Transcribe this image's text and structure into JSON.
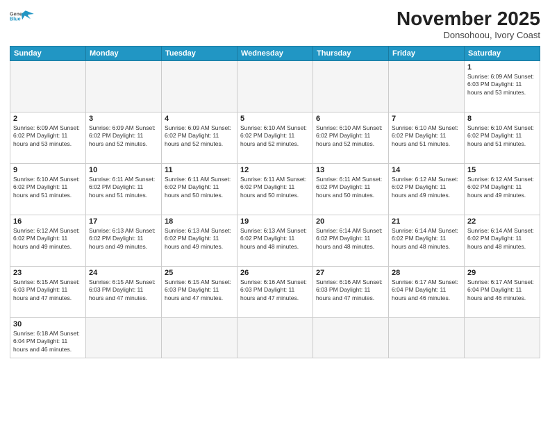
{
  "logo": {
    "line1": "General",
    "line2": "Blue"
  },
  "title": "November 2025",
  "location": "Donsohoou, Ivory Coast",
  "weekdays": [
    "Sunday",
    "Monday",
    "Tuesday",
    "Wednesday",
    "Thursday",
    "Friday",
    "Saturday"
  ],
  "weeks": [
    [
      {
        "day": "",
        "info": ""
      },
      {
        "day": "",
        "info": ""
      },
      {
        "day": "",
        "info": ""
      },
      {
        "day": "",
        "info": ""
      },
      {
        "day": "",
        "info": ""
      },
      {
        "day": "",
        "info": ""
      },
      {
        "day": "1",
        "info": "Sunrise: 6:09 AM\nSunset: 6:03 PM\nDaylight: 11 hours\nand 53 minutes."
      }
    ],
    [
      {
        "day": "2",
        "info": "Sunrise: 6:09 AM\nSunset: 6:02 PM\nDaylight: 11 hours\nand 53 minutes."
      },
      {
        "day": "3",
        "info": "Sunrise: 6:09 AM\nSunset: 6:02 PM\nDaylight: 11 hours\nand 52 minutes."
      },
      {
        "day": "4",
        "info": "Sunrise: 6:09 AM\nSunset: 6:02 PM\nDaylight: 11 hours\nand 52 minutes."
      },
      {
        "day": "5",
        "info": "Sunrise: 6:10 AM\nSunset: 6:02 PM\nDaylight: 11 hours\nand 52 minutes."
      },
      {
        "day": "6",
        "info": "Sunrise: 6:10 AM\nSunset: 6:02 PM\nDaylight: 11 hours\nand 52 minutes."
      },
      {
        "day": "7",
        "info": "Sunrise: 6:10 AM\nSunset: 6:02 PM\nDaylight: 11 hours\nand 51 minutes."
      },
      {
        "day": "8",
        "info": "Sunrise: 6:10 AM\nSunset: 6:02 PM\nDaylight: 11 hours\nand 51 minutes."
      }
    ],
    [
      {
        "day": "9",
        "info": "Sunrise: 6:10 AM\nSunset: 6:02 PM\nDaylight: 11 hours\nand 51 minutes."
      },
      {
        "day": "10",
        "info": "Sunrise: 6:11 AM\nSunset: 6:02 PM\nDaylight: 11 hours\nand 51 minutes."
      },
      {
        "day": "11",
        "info": "Sunrise: 6:11 AM\nSunset: 6:02 PM\nDaylight: 11 hours\nand 50 minutes."
      },
      {
        "day": "12",
        "info": "Sunrise: 6:11 AM\nSunset: 6:02 PM\nDaylight: 11 hours\nand 50 minutes."
      },
      {
        "day": "13",
        "info": "Sunrise: 6:11 AM\nSunset: 6:02 PM\nDaylight: 11 hours\nand 50 minutes."
      },
      {
        "day": "14",
        "info": "Sunrise: 6:12 AM\nSunset: 6:02 PM\nDaylight: 11 hours\nand 49 minutes."
      },
      {
        "day": "15",
        "info": "Sunrise: 6:12 AM\nSunset: 6:02 PM\nDaylight: 11 hours\nand 49 minutes."
      }
    ],
    [
      {
        "day": "16",
        "info": "Sunrise: 6:12 AM\nSunset: 6:02 PM\nDaylight: 11 hours\nand 49 minutes."
      },
      {
        "day": "17",
        "info": "Sunrise: 6:13 AM\nSunset: 6:02 PM\nDaylight: 11 hours\nand 49 minutes."
      },
      {
        "day": "18",
        "info": "Sunrise: 6:13 AM\nSunset: 6:02 PM\nDaylight: 11 hours\nand 49 minutes."
      },
      {
        "day": "19",
        "info": "Sunrise: 6:13 AM\nSunset: 6:02 PM\nDaylight: 11 hours\nand 48 minutes."
      },
      {
        "day": "20",
        "info": "Sunrise: 6:14 AM\nSunset: 6:02 PM\nDaylight: 11 hours\nand 48 minutes."
      },
      {
        "day": "21",
        "info": "Sunrise: 6:14 AM\nSunset: 6:02 PM\nDaylight: 11 hours\nand 48 minutes."
      },
      {
        "day": "22",
        "info": "Sunrise: 6:14 AM\nSunset: 6:02 PM\nDaylight: 11 hours\nand 48 minutes."
      }
    ],
    [
      {
        "day": "23",
        "info": "Sunrise: 6:15 AM\nSunset: 6:03 PM\nDaylight: 11 hours\nand 47 minutes."
      },
      {
        "day": "24",
        "info": "Sunrise: 6:15 AM\nSunset: 6:03 PM\nDaylight: 11 hours\nand 47 minutes."
      },
      {
        "day": "25",
        "info": "Sunrise: 6:15 AM\nSunset: 6:03 PM\nDaylight: 11 hours\nand 47 minutes."
      },
      {
        "day": "26",
        "info": "Sunrise: 6:16 AM\nSunset: 6:03 PM\nDaylight: 11 hours\nand 47 minutes."
      },
      {
        "day": "27",
        "info": "Sunrise: 6:16 AM\nSunset: 6:03 PM\nDaylight: 11 hours\nand 47 minutes."
      },
      {
        "day": "28",
        "info": "Sunrise: 6:17 AM\nSunset: 6:04 PM\nDaylight: 11 hours\nand 46 minutes."
      },
      {
        "day": "29",
        "info": "Sunrise: 6:17 AM\nSunset: 6:04 PM\nDaylight: 11 hours\nand 46 minutes."
      }
    ],
    [
      {
        "day": "30",
        "info": "Sunrise: 6:18 AM\nSunset: 6:04 PM\nDaylight: 11 hours\nand 46 minutes."
      },
      {
        "day": "",
        "info": ""
      },
      {
        "day": "",
        "info": ""
      },
      {
        "day": "",
        "info": ""
      },
      {
        "day": "",
        "info": ""
      },
      {
        "day": "",
        "info": ""
      },
      {
        "day": "",
        "info": ""
      }
    ]
  ]
}
